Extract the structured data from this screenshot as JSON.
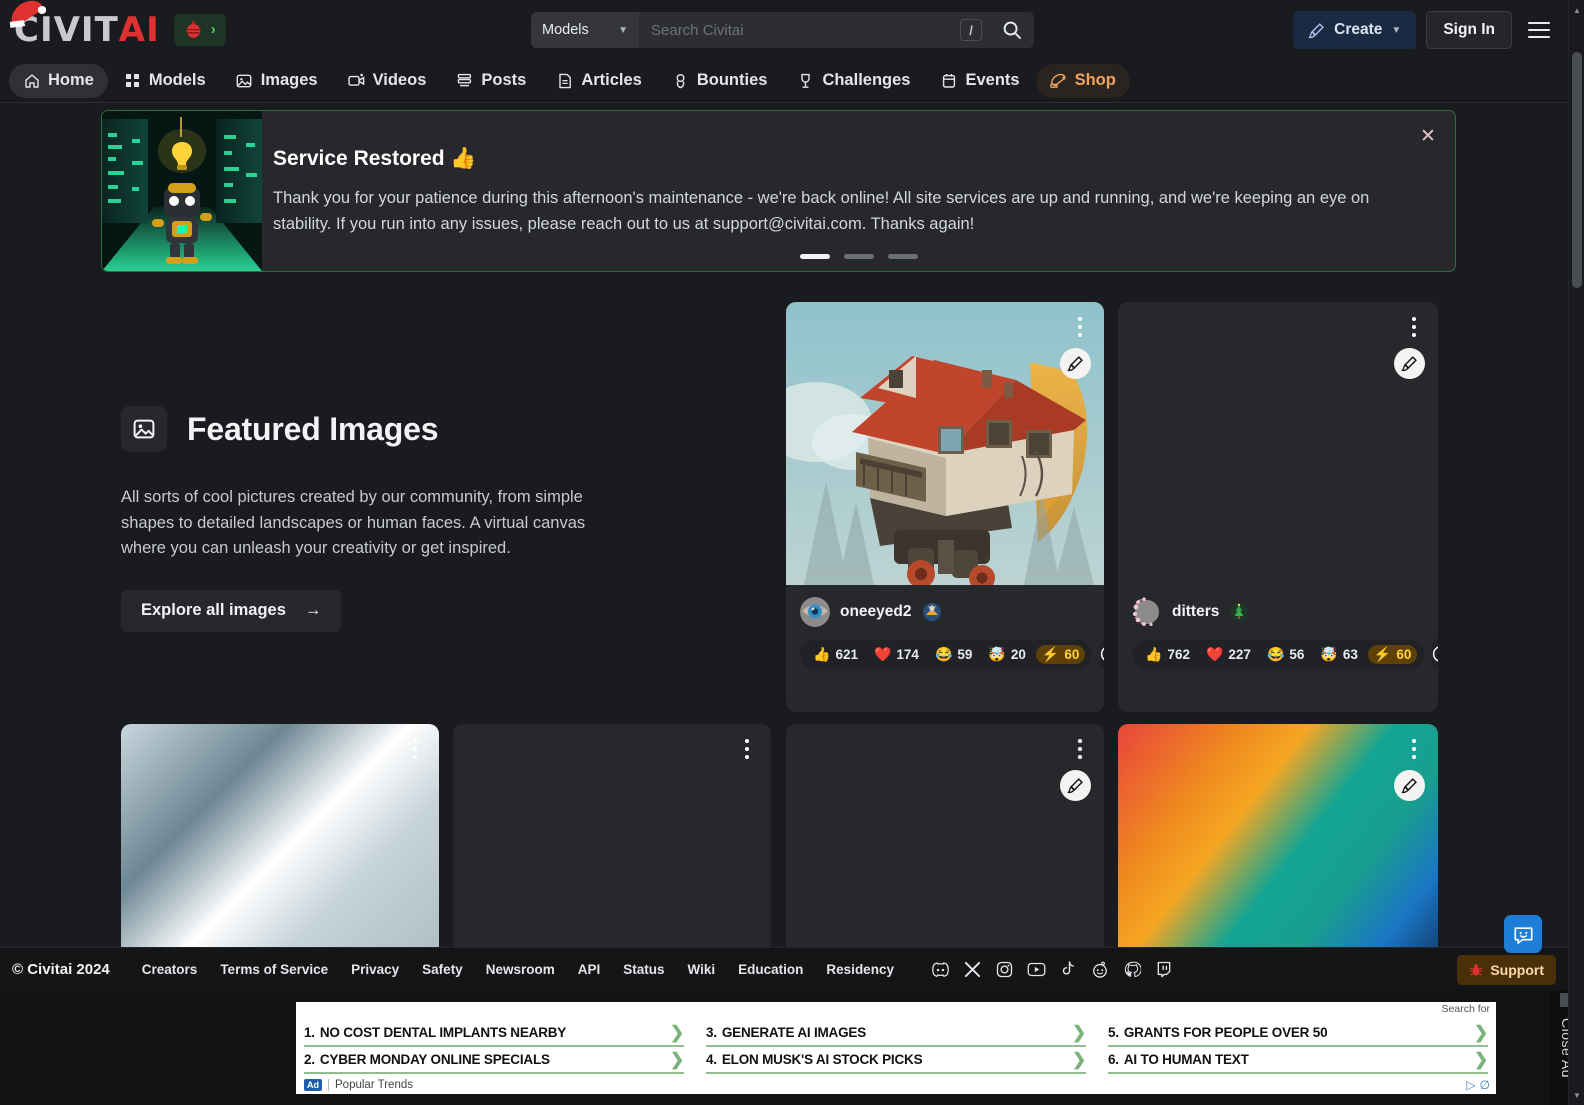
{
  "header": {
    "logo_civit": "CIVIT",
    "logo_ai": "AI",
    "xmas_badge_icon": "christmas-ornament-icon",
    "xmas_badge_chevron": "›",
    "search": {
      "category": "Models",
      "placeholder": "Search Civitai",
      "value": "",
      "shortcut_key": "/",
      "search_icon": "search-icon"
    },
    "create_label": "Create",
    "signin_label": "Sign In",
    "menu_icon": "hamburger-menu-icon"
  },
  "nav": {
    "items": [
      {
        "label": "Home",
        "icon": "home-icon",
        "active": true
      },
      {
        "label": "Models",
        "icon": "grid-icon",
        "active": false
      },
      {
        "label": "Images",
        "icon": "image-icon",
        "active": false
      },
      {
        "label": "Videos",
        "icon": "video-icon",
        "active": false
      },
      {
        "label": "Posts",
        "icon": "posts-icon",
        "active": false
      },
      {
        "label": "Articles",
        "icon": "article-icon",
        "active": false
      },
      {
        "label": "Bounties",
        "icon": "bounty-icon",
        "active": false
      },
      {
        "label": "Challenges",
        "icon": "trophy-icon",
        "active": false
      },
      {
        "label": "Events",
        "icon": "calendar-icon",
        "active": false
      },
      {
        "label": "Shop",
        "icon": "santa-hat-icon",
        "active": false
      }
    ]
  },
  "banner": {
    "title": "Service Restored 👍",
    "body": "Thank you for your patience during this afternoon's maintenance - we're back online! All site services are up and running, and we're keeping an eye on stability. If you run into any issues, please reach out to us at support@civitai.com. Thanks again!",
    "close_icon": "close-icon",
    "slides": 3,
    "active_slide": 1,
    "border_color": "#2f6b43"
  },
  "featured": {
    "icon": "image-icon",
    "title": "Featured Images",
    "description": "All sorts of cool pictures created by our community, from simple shapes to detailed landscapes or human faces. A virtual canvas where you can unleash your creativity or get inspired.",
    "cta_label": "Explore all images",
    "cta_arrow": "→"
  },
  "cards": [
    {
      "id": "card-house-walker",
      "username": "oneeyed2",
      "avatar": "eye-avatar",
      "badge": "cosmetic-badge",
      "has_image": true,
      "image_alt": "walking-house-artwork",
      "brush_icon": "brush-icon",
      "menu_icon": "more-vertical-icon",
      "info_icon": "info-icon",
      "reactions": [
        {
          "emoji": "👍",
          "name": "thumbs-up",
          "count": "621"
        },
        {
          "emoji": "❤️",
          "name": "heart",
          "count": "174"
        },
        {
          "emoji": "😂",
          "name": "laugh",
          "count": "59"
        },
        {
          "emoji": "🤯",
          "name": "mind-blown",
          "count": "20"
        },
        {
          "emoji": "⚡",
          "name": "buzz",
          "count": "60",
          "buzz": true
        }
      ]
    },
    {
      "id": "card-ditters",
      "username": "ditters",
      "avatar": "blossom-avatar",
      "badge": "christmas-tree-badge",
      "has_image": false,
      "image_alt": "",
      "brush_icon": "brush-icon",
      "menu_icon": "more-vertical-icon",
      "info_icon": "info-icon",
      "reactions": [
        {
          "emoji": "👍",
          "name": "thumbs-up",
          "count": "762"
        },
        {
          "emoji": "❤️",
          "name": "heart",
          "count": "227"
        },
        {
          "emoji": "😂",
          "name": "laugh",
          "count": "56"
        },
        {
          "emoji": "🤯",
          "name": "mind-blown",
          "count": "63"
        },
        {
          "emoji": "⚡",
          "name": "buzz",
          "count": "60",
          "buzz": true
        }
      ]
    }
  ],
  "footer": {
    "copyright": "© Civitai 2024",
    "links": [
      "Creators",
      "Terms of Service",
      "Privacy",
      "Safety",
      "Newsroom",
      "API",
      "Status",
      "Wiki",
      "Education",
      "Residency"
    ],
    "socials": [
      "discord-icon",
      "x-icon",
      "instagram-icon",
      "youtube-icon",
      "tiktok-icon",
      "reddit-icon",
      "github-icon",
      "twitch-icon"
    ],
    "support_label": "Support",
    "support_icon": "bug-icon"
  },
  "ad": {
    "search_for_label": "Search for",
    "items": [
      {
        "num": "1.",
        "text": "NO COST DENTAL IMPLANTS NEARBY"
      },
      {
        "num": "2.",
        "text": "CYBER MONDAY ONLINE SPECIALS"
      },
      {
        "num": "3.",
        "text": "GENERATE AI IMAGES"
      },
      {
        "num": "4.",
        "text": "ELON MUSK'S AI STOCK PICKS"
      },
      {
        "num": "5.",
        "text": "GRANTS FOR PEOPLE OVER 50"
      },
      {
        "num": "6.",
        "text": "AI TO HUMAN TEXT"
      }
    ],
    "tag": "Ad",
    "popular_trends": "Popular Trends",
    "arrow": "❯",
    "close_label": "Close Ad"
  },
  "chat": {
    "icon": "chat-smiley-icon"
  }
}
